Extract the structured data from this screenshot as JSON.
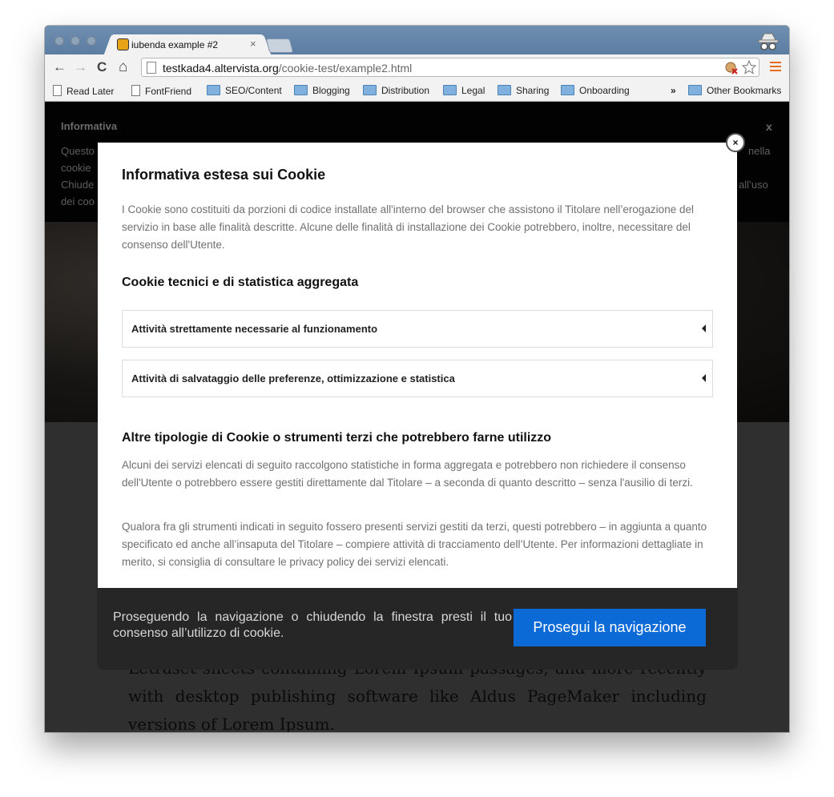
{
  "browser": {
    "tab_title": "iubenda example #2",
    "tab_close": "×",
    "url_host": "testkada4.altervista.org",
    "url_path": "/cookie-test/example2.html",
    "back": "←",
    "forward": "→",
    "reload": "C",
    "home": "⌂",
    "bookmarks": [
      {
        "label": "Read Later",
        "icon": "file-icon"
      },
      {
        "label": "FontFriend",
        "icon": "file-icon"
      },
      {
        "label": "SEO/Content",
        "icon": "folder-icon"
      },
      {
        "label": "Blogging",
        "icon": "folder-icon"
      },
      {
        "label": "Distribution",
        "icon": "folder-icon"
      },
      {
        "label": "Legal",
        "icon": "folder-icon"
      },
      {
        "label": "Sharing",
        "icon": "folder-icon"
      },
      {
        "label": "Onboarding",
        "icon": "folder-icon"
      },
      {
        "label": "Other Bookmarks",
        "icon": "folder-icon"
      }
    ],
    "bookmarks_overflow": "»"
  },
  "page": {
    "info_title": "Informativa",
    "info_close": "x",
    "bg_fragments": [
      "Questo",
      "cookie",
      "Chiude",
      "dei coo",
      "nella",
      "all’uso"
    ],
    "article_text": "Letraset sheets containing Lorem Ipsum passages, and more recently with desktop publishing software like Aldus PageMaker including versions of Lorem Ipsum."
  },
  "modal": {
    "close": "×",
    "title": "Informativa estesa sui Cookie",
    "intro": "I Cookie sono costituiti da porzioni di codice installate all'interno del browser che assistono il Titolare nell’erogazione del servizio in base alle finalità descritte. Alcune delle finalità di installazione dei Cookie potrebbero, inoltre, necessitare del consenso dell'Utente.",
    "section1_title": "Cookie tecnici e di statistica aggregata",
    "accordion": [
      "Attività strettamente necessarie al funzionamento",
      "Attività di salvataggio delle preferenze, ottimizzazione e statistica"
    ],
    "section2_title": "Altre tipologie di Cookie o strumenti terzi che potrebbero farne utilizzo",
    "para1": "Alcuni dei servizi elencati di seguito raccolgono statistiche in forma aggregata e potrebbero non richiedere il consenso dell'Utente o potrebbero essere gestiti direttamente dal Titolare – a seconda di quanto descritto – senza l'ausilio di terzi.",
    "para2": "Qualora fra gli strumenti indicati in seguito fossero presenti servizi gestiti da terzi, questi potrebbero – in aggiunta a quanto specificato ed anche all’insaputa del Titolare – compiere attività di tracciamento dell’Utente. Per informazioni dettagliate in merito, si consiglia di consultare le privacy policy dei servizi elencati."
  },
  "cookie_bar": {
    "text": "Proseguendo la navigazione o chiudendo la finestra presti il tuo consenso all’utilizzo di cookie.",
    "button": "Prosegui la navigazione"
  },
  "colors": {
    "titlebar": "#5b7da2",
    "button_blue": "#0c6ad6",
    "cookie_bar": "#262626"
  }
}
